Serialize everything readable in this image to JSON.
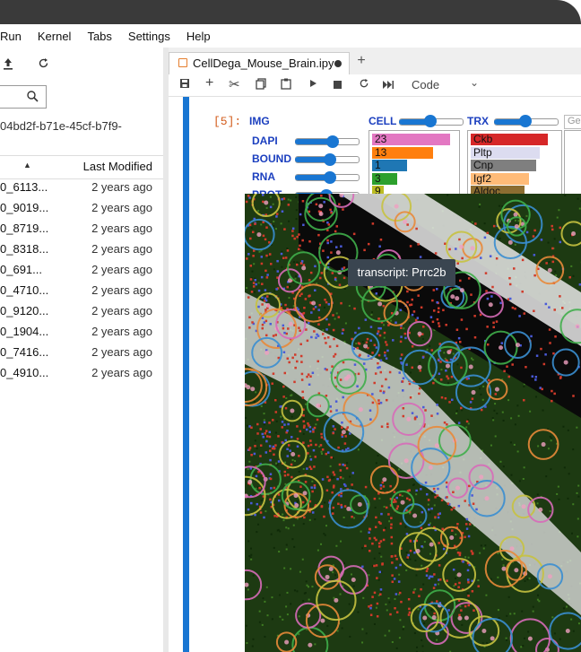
{
  "menubar": {
    "items": [
      "Run",
      "Kernel",
      "Tabs",
      "Settings",
      "Help"
    ]
  },
  "filebrowser": {
    "path": "04bd2f-b71e-45cf-b7f9-",
    "header": {
      "last_modified": "Last Modified"
    },
    "rows": [
      {
        "name": "0_6113...",
        "modified": "2 years ago"
      },
      {
        "name": "0_9019...",
        "modified": "2 years ago"
      },
      {
        "name": "0_8719...",
        "modified": "2 years ago"
      },
      {
        "name": "0_8318...",
        "modified": "2 years ago"
      },
      {
        "name": "0_691...",
        "modified": "2 years ago"
      },
      {
        "name": "0_4710...",
        "modified": "2 years ago"
      },
      {
        "name": "0_9120...",
        "modified": "2 years ago"
      },
      {
        "name": "0_1904...",
        "modified": "2 years ago"
      },
      {
        "name": "0_7416...",
        "modified": "2 years ago"
      },
      {
        "name": "0_4910...",
        "modified": "2 years ago"
      }
    ]
  },
  "notebook": {
    "tab_label": "CellDega_Mouse_Brain.ipy",
    "cell_type": "Code",
    "prompt": "[5]:"
  },
  "widget": {
    "img_label": "IMG",
    "channels": [
      {
        "label": "DAPI",
        "level": 0.6
      },
      {
        "label": "BOUND",
        "level": 0.55
      },
      {
        "label": "RNA",
        "level": 0.55
      },
      {
        "label": "PROT",
        "level": 0.5
      }
    ],
    "cell_label": "CELL",
    "cell_slider_level": 0.5,
    "trx_label": "TRX",
    "trx_slider_level": 0.5,
    "gene_placeholder": "Ge",
    "cell_bars": [
      {
        "label": "23",
        "color": "#e377c2",
        "fraction": 1.0
      },
      {
        "label": "13",
        "color": "#ff7f0e",
        "fraction": 0.78
      },
      {
        "label": "1",
        "color": "#1f77b4",
        "fraction": 0.45
      },
      {
        "label": "3",
        "color": "#2ca02c",
        "fraction": 0.32
      },
      {
        "label": "9",
        "color": "#bcbd22",
        "fraction": 0.15
      }
    ],
    "trx_bars": [
      {
        "label": "Ckb",
        "color": "#d62728",
        "fraction": 1.0
      },
      {
        "label": "Pltp",
        "color": "#dcdcf0",
        "fraction": 0.9
      },
      {
        "label": "Cnp",
        "color": "#7f7f7f",
        "fraction": 0.85
      },
      {
        "label": "Igf2",
        "color": "#ffbb78",
        "fraction": 0.75
      },
      {
        "label": "Aldoc",
        "color": "#8c6d31",
        "fraction": 0.7
      }
    ]
  },
  "tooltip": "transcript: Prrc2b"
}
